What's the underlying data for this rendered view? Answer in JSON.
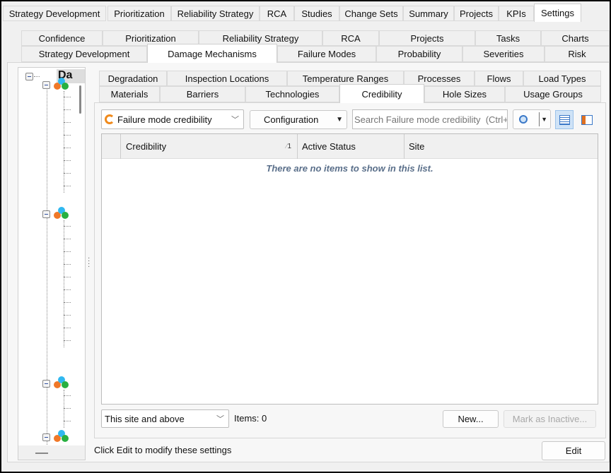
{
  "top_tabs": [
    "Strategy Development",
    "Prioritization",
    "Reliability Strategy",
    "RCA",
    "Studies",
    "Change Sets",
    "Summary",
    "Projects",
    "KPIs",
    "Settings"
  ],
  "top_selected": "Settings",
  "settings_tabs_row1": [
    "Confidence",
    "Prioritization",
    "Reliability Strategy",
    "RCA",
    "Projects",
    "Tasks",
    "Charts"
  ],
  "settings_tabs_row2": [
    "Strategy Development",
    "Damage Mechanisms",
    "Failure Modes",
    "Probability",
    "Severities",
    "Risk"
  ],
  "settings_selected": "Damage Mechanisms",
  "dm_tabs_row1": [
    "Degradation",
    "Inspection Locations",
    "Temperature Ranges",
    "Processes",
    "Flows",
    "Load Types"
  ],
  "dm_tabs_row2": [
    "Materials",
    "Barriers",
    "Technologies",
    "Credibility",
    "Hole Sizes",
    "Usage Groups"
  ],
  "dm_selected": "Credibility",
  "tree": {
    "root_label": "Da"
  },
  "toolbar": {
    "view_select": "Failure mode credibility",
    "configuration": "Configuration",
    "search_placeholder": "Search Failure mode credibility  (Ctrl+F)"
  },
  "grid": {
    "columns": [
      "Credibility",
      "Active Status",
      "Site"
    ],
    "sort_indicator": "1",
    "empty_message": "There are no items to show in this list."
  },
  "footer": {
    "scope_select": "This site and above",
    "items_count": "Items: 0",
    "new_button": "New...",
    "inactive_button": "Mark as Inactive..."
  },
  "status": {
    "message": "Click Edit to modify these settings",
    "edit_button": "Edit"
  },
  "colors": {
    "accent": "#3a78c8",
    "empty_text": "#5a6f8a"
  }
}
